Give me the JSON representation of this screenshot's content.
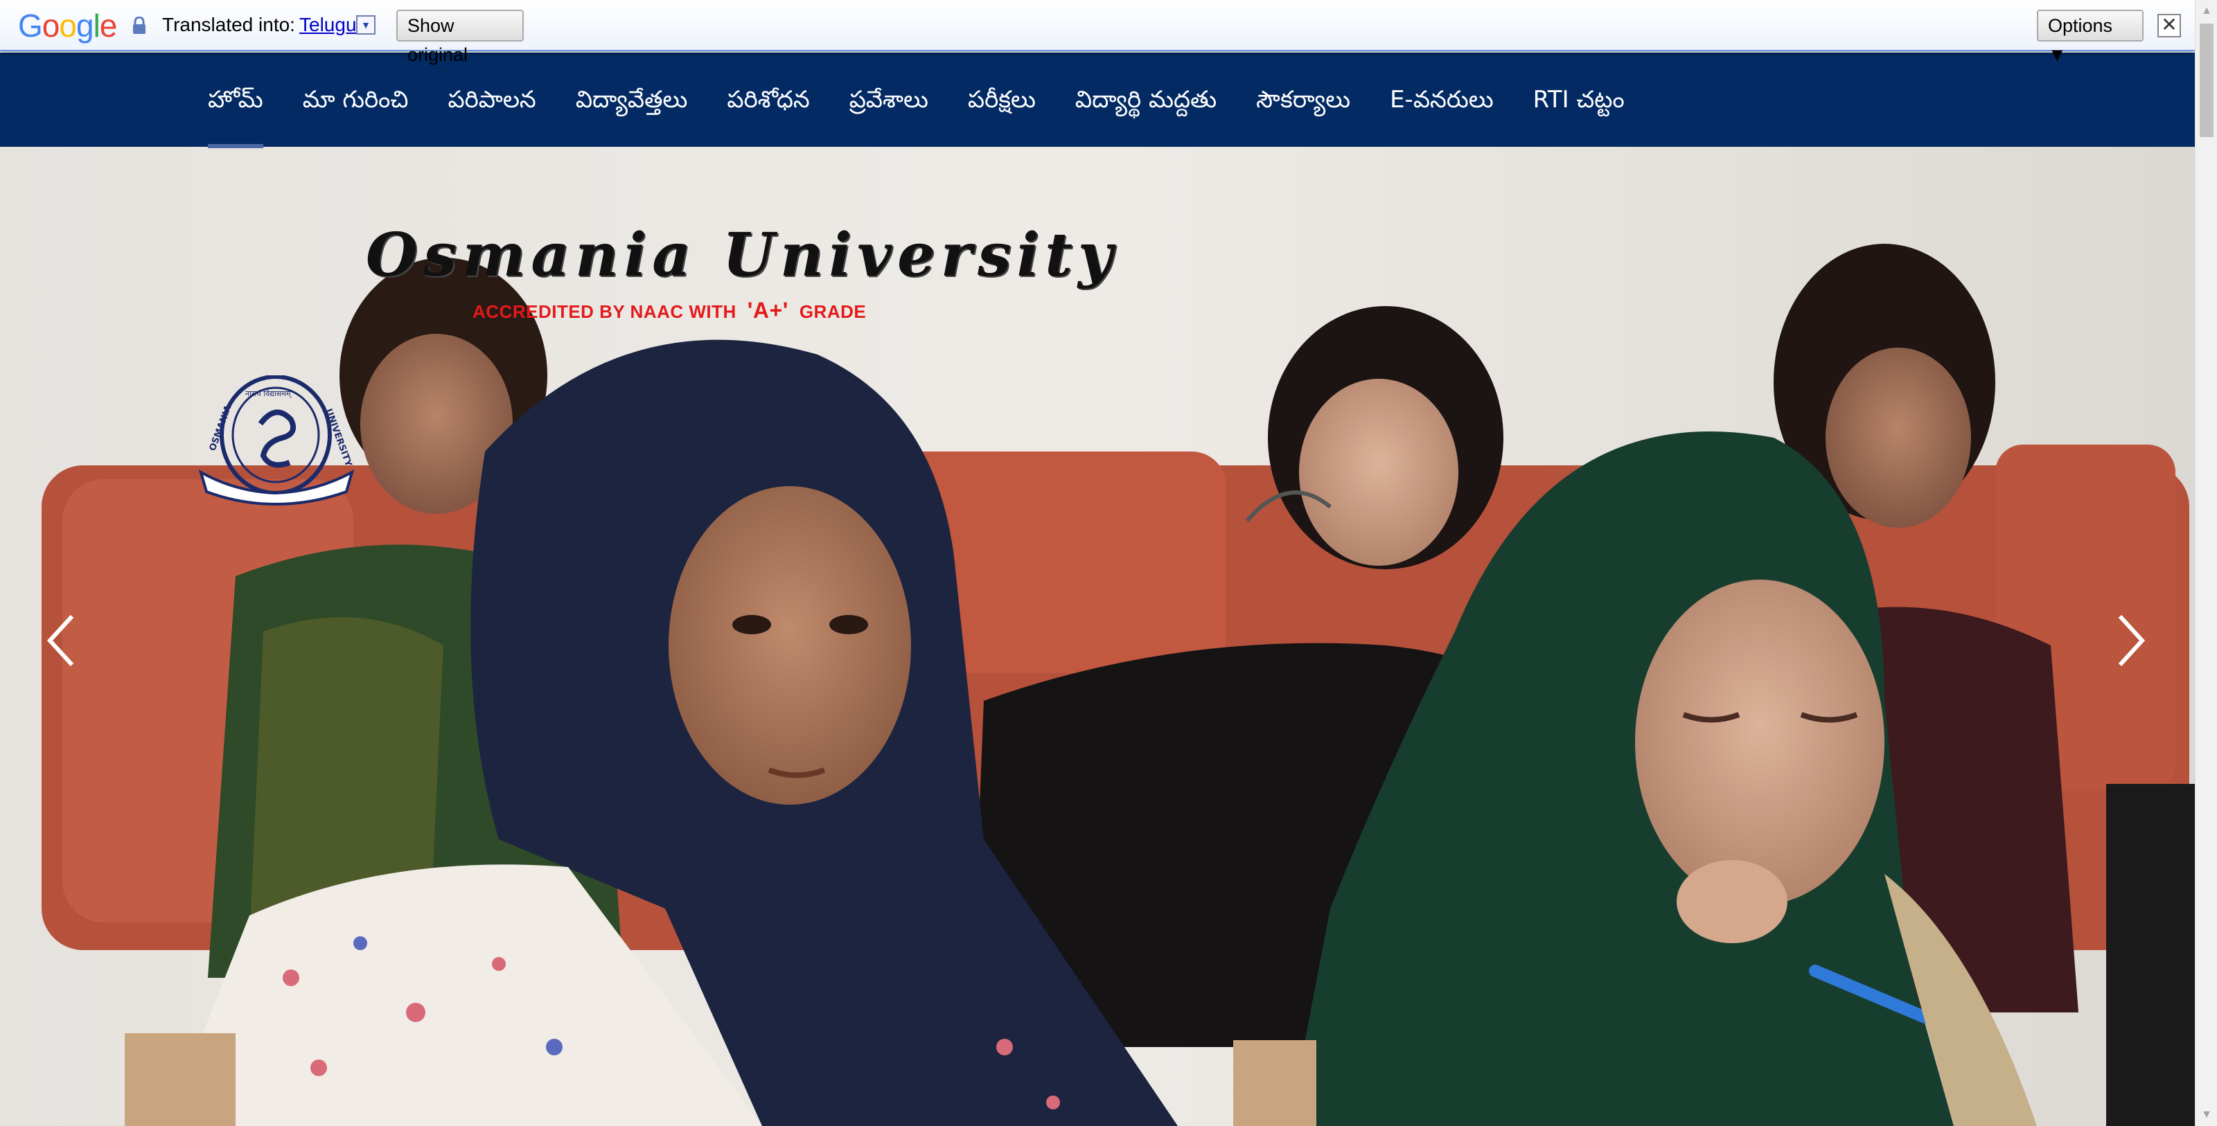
{
  "translate_bar": {
    "logo_text": "Google",
    "label": "Translated into:",
    "language": "Telugu",
    "show_original_label": "Show original",
    "options_label": "Options ▼",
    "close_label": "✕"
  },
  "nav": {
    "items": [
      {
        "label": "హోమ్",
        "active": true
      },
      {
        "label": "మా గురించి"
      },
      {
        "label": "పరిపాలన"
      },
      {
        "label": "విద్యావేత్తలు"
      },
      {
        "label": "పరిశోధన"
      },
      {
        "label": "ప్రవేశాలు"
      },
      {
        "label": "పరీక్షలు"
      },
      {
        "label": "విద్యార్థి మద్దతు"
      },
      {
        "label": "సౌకర్యాలు"
      },
      {
        "label": "E-వనరులు"
      },
      {
        "label": "RTI చట్టం"
      }
    ]
  },
  "hero": {
    "university_name": "Osmania University",
    "accreditation_prefix": "ACCREDITED BY NAAC WITH",
    "accreditation_grade": "'A+'",
    "accreditation_suffix": "GRADE",
    "seal_text_left": "OSMANIA",
    "seal_text_right": "UNIVERSITY",
    "seal_text_top": "नास्त्य विद्यासमम्",
    "prev_icon": "chevron-left-icon",
    "next_icon": "chevron-right-icon"
  },
  "colors": {
    "nav_background": "#032a63",
    "accreditation_red": "#e41a1a",
    "translate_link": "#0000cc"
  }
}
